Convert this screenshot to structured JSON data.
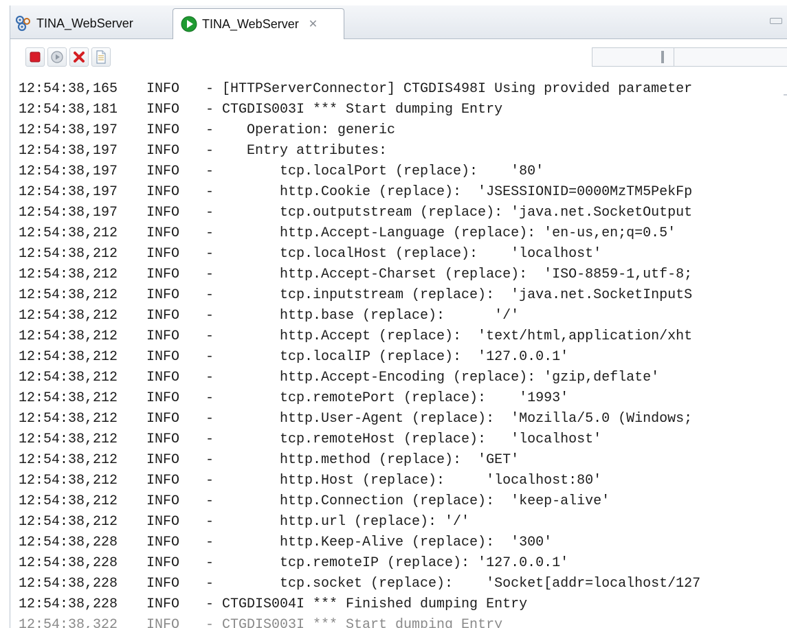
{
  "tabs": [
    {
      "label": "TINA_WebServer",
      "icon": "server-config-icon",
      "active": false
    },
    {
      "label": "TINA_WebServer",
      "icon": "run-icon",
      "active": true,
      "close_glyph": "✕"
    }
  ],
  "toolbar": {
    "buttons": [
      {
        "name": "stop-button",
        "icon": "stop-icon"
      },
      {
        "name": "debug-button",
        "icon": "debug-icon"
      },
      {
        "name": "remove-button",
        "icon": "remove-icon"
      },
      {
        "name": "clear-console-button",
        "icon": "clear-icon"
      }
    ]
  },
  "colors": {
    "stop": "#d81d2a",
    "run": "#1f9a32",
    "remove": "#d41e22",
    "tab_border": "#a7b1bd"
  },
  "log": [
    {
      "ts": "12:54:38,165",
      "level": "INFO",
      "msg": "[HTTPServerConnector] CTGDIS498I Using provided parameter"
    },
    {
      "ts": "12:54:38,181",
      "level": "INFO",
      "msg": "CTGDIS003I *** Start dumping Entry"
    },
    {
      "ts": "12:54:38,197",
      "level": "INFO",
      "msg": "   Operation: generic"
    },
    {
      "ts": "12:54:38,197",
      "level": "INFO",
      "msg": "   Entry attributes:"
    },
    {
      "ts": "12:54:38,197",
      "level": "INFO",
      "msg": "       tcp.localPort (replace):    '80'"
    },
    {
      "ts": "12:54:38,197",
      "level": "INFO",
      "msg": "       http.Cookie (replace):  'JSESSIONID=0000MzTM5PekFp"
    },
    {
      "ts": "12:54:38,197",
      "level": "INFO",
      "msg": "       tcp.outputstream (replace): 'java.net.SocketOutput"
    },
    {
      "ts": "12:54:38,212",
      "level": "INFO",
      "msg": "       http.Accept-Language (replace): 'en-us,en;q=0.5'"
    },
    {
      "ts": "12:54:38,212",
      "level": "INFO",
      "msg": "       tcp.localHost (replace):    'localhost'"
    },
    {
      "ts": "12:54:38,212",
      "level": "INFO",
      "msg": "       http.Accept-Charset (replace):  'ISO-8859-1,utf-8;"
    },
    {
      "ts": "12:54:38,212",
      "level": "INFO",
      "msg": "       tcp.inputstream (replace):  'java.net.SocketInputS"
    },
    {
      "ts": "12:54:38,212",
      "level": "INFO",
      "msg": "       http.base (replace):      '/'"
    },
    {
      "ts": "12:54:38,212",
      "level": "INFO",
      "msg": "       http.Accept (replace):  'text/html,application/xht"
    },
    {
      "ts": "12:54:38,212",
      "level": "INFO",
      "msg": "       tcp.localIP (replace):  '127.0.0.1'"
    },
    {
      "ts": "12:54:38,212",
      "level": "INFO",
      "msg": "       http.Accept-Encoding (replace): 'gzip,deflate'"
    },
    {
      "ts": "12:54:38,212",
      "level": "INFO",
      "msg": "       tcp.remotePort (replace):    '1993'"
    },
    {
      "ts": "12:54:38,212",
      "level": "INFO",
      "msg": "       http.User-Agent (replace):  'Mozilla/5.0 (Windows;"
    },
    {
      "ts": "12:54:38,212",
      "level": "INFO",
      "msg": "       tcp.remoteHost (replace):   'localhost'"
    },
    {
      "ts": "12:54:38,212",
      "level": "INFO",
      "msg": "       http.method (replace):  'GET'"
    },
    {
      "ts": "12:54:38,212",
      "level": "INFO",
      "msg": "       http.Host (replace):     'localhost:80'"
    },
    {
      "ts": "12:54:38,212",
      "level": "INFO",
      "msg": "       http.Connection (replace):  'keep-alive'"
    },
    {
      "ts": "12:54:38,212",
      "level": "INFO",
      "msg": "       http.url (replace): '/'"
    },
    {
      "ts": "12:54:38,228",
      "level": "INFO",
      "msg": "       http.Keep-Alive (replace):  '300'"
    },
    {
      "ts": "12:54:38,228",
      "level": "INFO",
      "msg": "       tcp.remoteIP (replace): '127.0.0.1'"
    },
    {
      "ts": "12:54:38,228",
      "level": "INFO",
      "msg": "       tcp.socket (replace):    'Socket[addr=localhost/127"
    },
    {
      "ts": "12:54:38,228",
      "level": "INFO",
      "msg": "CTGDIS004I *** Finished dumping Entry"
    },
    {
      "ts": "12:54:38,322",
      "level": "INFO",
      "msg": "CTGDIS003I *** Start dumping Entry"
    }
  ]
}
